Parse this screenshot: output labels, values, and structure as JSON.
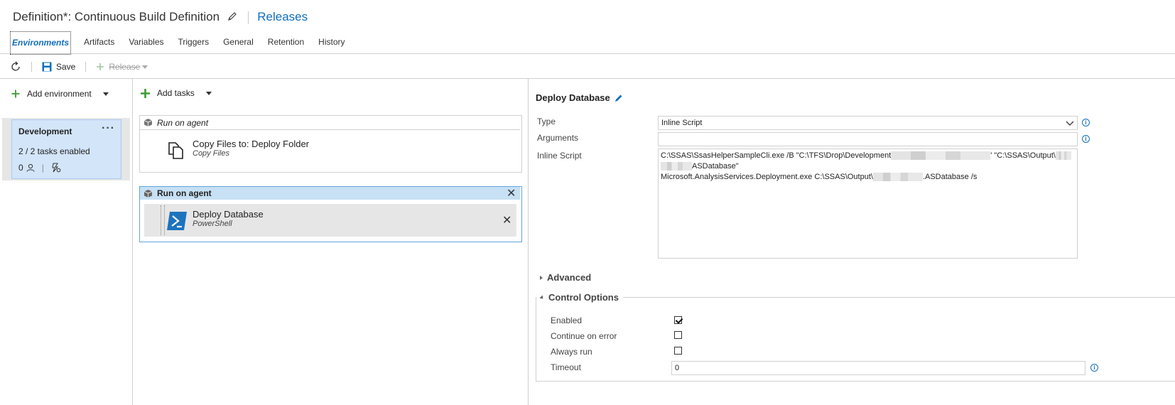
{
  "header": {
    "title": "Definition*: Continuous Build Definition",
    "releases_link": "Releases"
  },
  "tabs": [
    "Environments",
    "Artifacts",
    "Variables",
    "Triggers",
    "General",
    "Retention",
    "History"
  ],
  "toolbar": {
    "save_label": "Save",
    "release_label": "Release"
  },
  "left": {
    "add_environment_label": "Add environment",
    "environment": {
      "name": "Development",
      "tasks_enabled": "2 / 2 tasks enabled",
      "approvers_count": "0"
    }
  },
  "middle": {
    "add_tasks_label": "Add tasks",
    "phase1": {
      "label": "Run on agent",
      "task_title": "Copy Files to: Deploy Folder",
      "task_sub": "Copy Files"
    },
    "phase2": {
      "label": "Run on agent",
      "task_title": "Deploy Database",
      "task_sub": "PowerShell"
    }
  },
  "right": {
    "title": "Deploy Database",
    "type_label": "Type",
    "type_value": "Inline Script",
    "arguments_label": "Arguments",
    "arguments_value": "",
    "inline_script_label": "Inline Script",
    "script_line1a": "C:\\SSAS\\SsasHelperSampleCli.exe /B \"C:\\TFS\\Drop\\Development",
    "script_line1b": "' \"C:\\SSAS\\Output\\",
    "script_line2": "ASDatabase\"",
    "script_line3a": "Microsoft.AnalysisServices.Deployment.exe C:\\SSAS\\Output\\",
    "script_line3b": ".ASDatabase /s",
    "advanced_label": "Advanced",
    "control_options_label": "Control Options",
    "enabled_label": "Enabled",
    "enabled_checked": true,
    "continue_on_error_label": "Continue on error",
    "continue_on_error_checked": false,
    "always_run_label": "Always run",
    "always_run_checked": false,
    "timeout_label": "Timeout",
    "timeout_value": "0"
  },
  "colors": {
    "accent": "#106ebe",
    "selected_env": "#d3e5f9",
    "phase_header": "#c7e0f4",
    "add_icon": "#3a9b35"
  }
}
